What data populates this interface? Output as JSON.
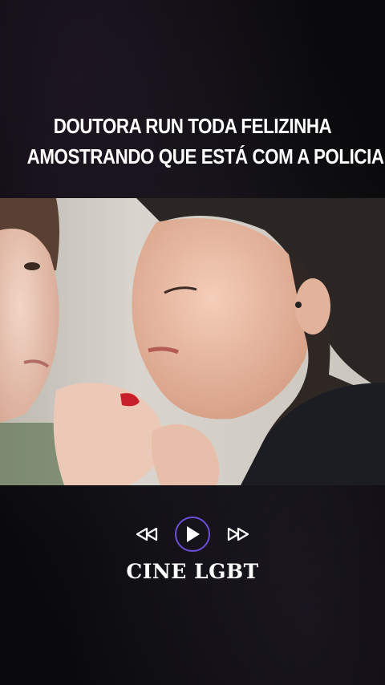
{
  "caption": {
    "line1": "DOUTORA RUN TODA FELIZINHA",
    "line2": "AMOSTRANDO QUE ESTÁ COM A POLICIAL"
  },
  "video": {
    "description_icon": "video-frame"
  },
  "controls": {
    "rewind_icon": "rewind-icon",
    "play_icon": "play-icon",
    "forward_icon": "fast-forward-icon",
    "accent_color": "#6b4fd8"
  },
  "brand": {
    "name": "CINE LGBT"
  }
}
